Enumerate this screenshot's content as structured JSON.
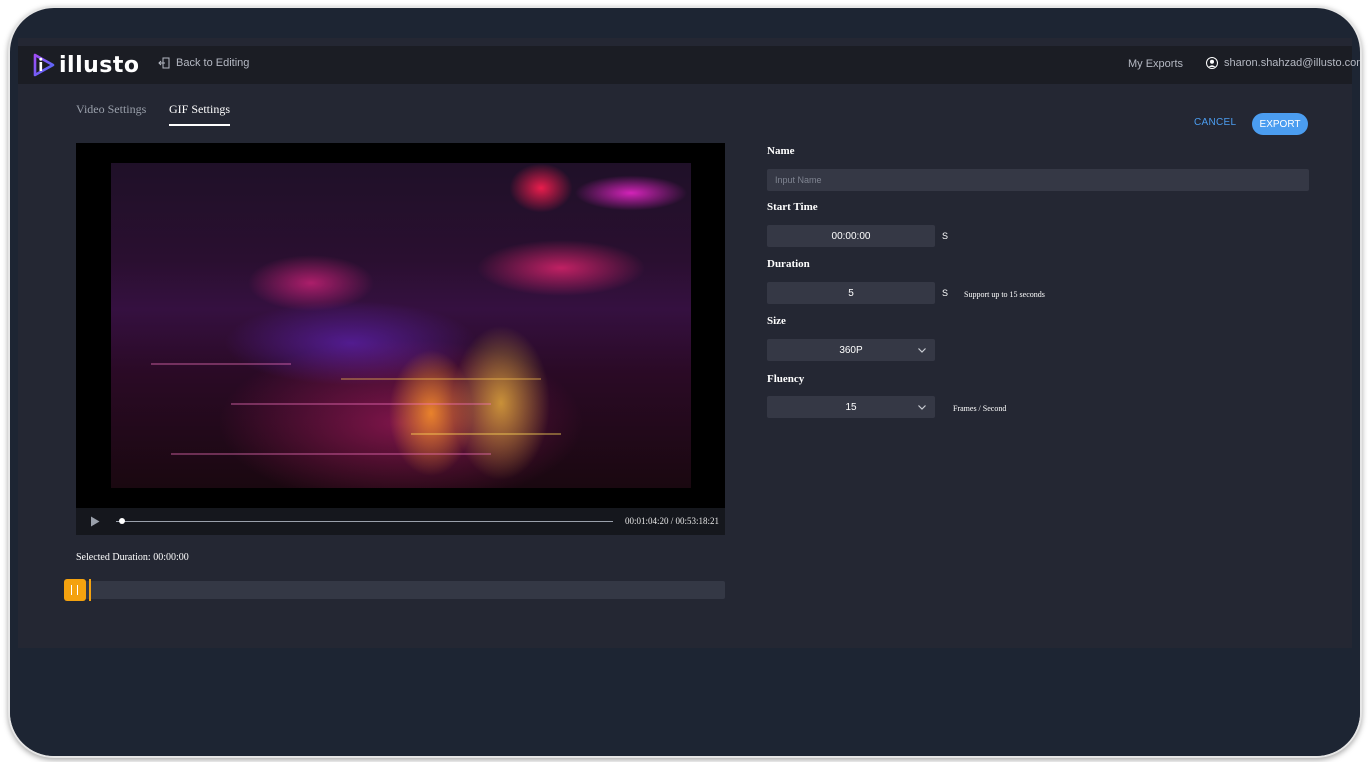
{
  "header": {
    "logo_text": "illusto",
    "back_label": "Back to Editing",
    "my_exports_label": "My Exports",
    "user_email": "sharon.shahzad@illusto.com"
  },
  "tabs": [
    {
      "label": "Video Settings",
      "active": false
    },
    {
      "label": "GIF Settings",
      "active": true
    }
  ],
  "actions": {
    "cancel_label": "CANCEL",
    "export_label": "EXPORT"
  },
  "player": {
    "timecode": "00:01:04:20 / 00:53:18:21",
    "progress": 0.02
  },
  "selection": {
    "selected_duration": "Selected Duration: 00:00:00"
  },
  "form": {
    "name_label": "Name",
    "name_placeholder": "Input Name",
    "name_value": "",
    "start_time_label": "Start Time",
    "start_time_value": "00:00:00",
    "start_time_unit": "S",
    "duration_label": "Duration",
    "duration_value": "5",
    "duration_unit": "S",
    "duration_note": "Support up to 15 seconds",
    "size_label": "Size",
    "size_value": "360P",
    "fluency_label": "Fluency",
    "fluency_value": "15",
    "fluency_unit": "Frames / Second"
  },
  "colors": {
    "accent": "#4b9df0",
    "handle": "#f4a20f",
    "background": "#242733",
    "topbar": "#1b1d24"
  },
  "icons": {
    "logo": "illusto-play-logo-icon",
    "back": "exit-door-icon",
    "user": "user-avatar-icon",
    "play": "play-icon",
    "dropdown": "chevron-down-icon"
  }
}
